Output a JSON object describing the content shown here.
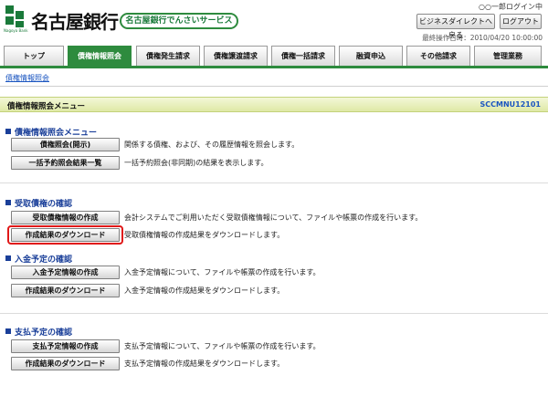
{
  "header": {
    "logo_sub": "Nagoya Bank",
    "bank_name": "名古屋銀行",
    "service_name": "名古屋銀行でんさいサービス",
    "user_status": "○○一郎ログイン中",
    "btn_business": "ビジネスダイレクトへ戻る",
    "btn_logout": "ログアウト",
    "last_operation": "最終操作日時：2010/04/20 10:00:00"
  },
  "tabs": [
    "トップ",
    "債権情報照会",
    "債権発生請求",
    "債権譲渡請求",
    "債権一括請求",
    "融資申込",
    "その他請求",
    "管理業務"
  ],
  "subnav": {
    "link": "債権情報照会"
  },
  "page": {
    "title": "債権情報照会メニュー",
    "screen_id": "SCCMNU12101"
  },
  "sections": [
    {
      "title": "債権情報照会メニュー",
      "items": [
        {
          "button": "債権照会(開示)",
          "desc": "関係する債権、および、その履歴情報を照会します。"
        },
        {
          "button": "一括予約照会結果一覧",
          "desc": "一括予約照会(非同期)の結果を表示します。"
        }
      ]
    },
    {
      "title": "受取債権の確認",
      "items": [
        {
          "button": "受取債権情報の作成",
          "desc": "会計システムでご利用いただく受取債権情報について、ファイルや帳票の作成を行います。"
        },
        {
          "button": "作成結果のダウンロード",
          "desc": "受取債権情報の作成結果をダウンロードします。"
        }
      ]
    },
    {
      "title": "入金予定の確認",
      "items": [
        {
          "button": "入金予定情報の作成",
          "desc": "入金予定情報について、ファイルや帳票の作成を行います。"
        },
        {
          "button": "作成結果のダウンロード",
          "desc": "入金予定情報の作成結果をダウンロードします。"
        }
      ]
    },
    {
      "title": "支払予定の確認",
      "items": [
        {
          "button": "支払予定情報の作成",
          "desc": "支払予定情報について、ファイルや帳票の作成を行います。"
        },
        {
          "button": "作成結果のダウンロード",
          "desc": "支払予定情報の作成結果をダウンロードします。"
        }
      ]
    }
  ],
  "colors": {
    "brand_green": "#2e8b3e",
    "section_blue": "#1a3f99",
    "highlight_red": "#e01818"
  }
}
